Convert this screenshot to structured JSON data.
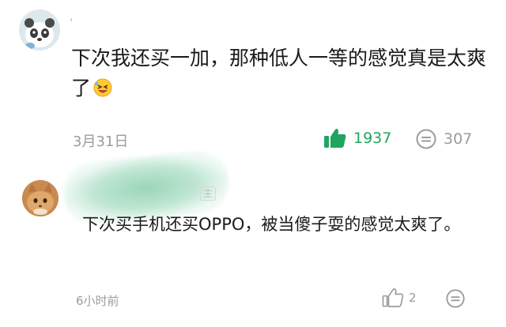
{
  "comments": [
    {
      "name_marker": "’",
      "text": "下次我还买一加，那种低人一等的感觉真是太爽了",
      "emoji": "laughing-face-emoji",
      "date": "3月31日",
      "likes": "1937",
      "replies": "307",
      "like_color": "#22a360"
    },
    {
      "owner_tag": "主",
      "text": "下次买手机还买OPPO，被当傻子耍的感觉太爽了。",
      "date": "6小时前",
      "likes": "2"
    }
  ],
  "icons": {
    "like": "thumbs-up-icon",
    "reply": "comment-bubble-icon"
  }
}
